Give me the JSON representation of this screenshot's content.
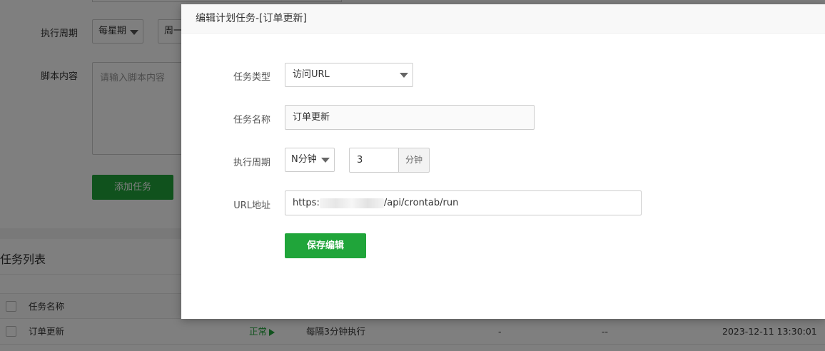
{
  "background": {
    "form": {
      "cycle_label": "执行周期",
      "cycle_value": "每星期",
      "day_value": "周一",
      "script_label": "脚本内容",
      "script_placeholder": "请输入脚本内容",
      "add_button": "添加任务"
    },
    "list": {
      "title": "任务列表",
      "header": {
        "name": "任务名称"
      },
      "rows": [
        {
          "name": "订单更新",
          "status": "正常",
          "cycle": "每隔3分钟执行",
          "col4": "-",
          "col5": "--",
          "time": "2023-12-11 13:30:01"
        }
      ]
    }
  },
  "modal": {
    "title": "编辑计划任务-[订单更新]",
    "task_type_label": "任务类型",
    "task_type_value": "访问URL",
    "task_name_label": "任务名称",
    "task_name_value": "订单更新",
    "cycle_label": "执行周期",
    "cycle_type_value": "N分钟",
    "cycle_number_value": "3",
    "cycle_unit": "分钟",
    "url_label": "URL地址",
    "url_prefix": "https:",
    "url_suffix": "/api/crontab/run",
    "save_button": "保存编辑"
  },
  "colors": {
    "accent": "#20a53a",
    "overlay": "rgba(0,0,0,0.5)"
  }
}
